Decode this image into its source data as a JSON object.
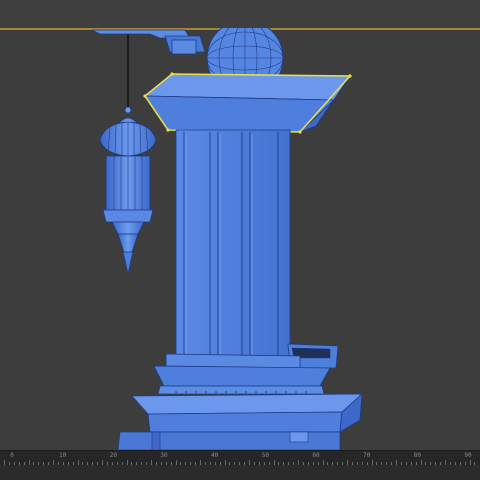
{
  "app": {
    "name": "",
    "mode": "3d-viewport"
  },
  "viewport": {
    "border_color": "#a8843a",
    "background": "#3d3d3d",
    "object_color": "#4f7fdc",
    "wire_color": "#1e3b85",
    "selection_color": "#e8dc4a"
  },
  "scene": {
    "objects": [
      {
        "name": "pillar",
        "selected": false
      },
      {
        "name": "capital-slab",
        "selected": true
      },
      {
        "name": "globe",
        "selected": false
      },
      {
        "name": "hanging-lantern",
        "selected": false
      },
      {
        "name": "pedestal-base",
        "selected": false
      }
    ]
  },
  "timeline": {
    "ticks": [
      "0",
      "10",
      "20",
      "30",
      "40",
      "50",
      "60",
      "70",
      "80",
      "90"
    ]
  }
}
